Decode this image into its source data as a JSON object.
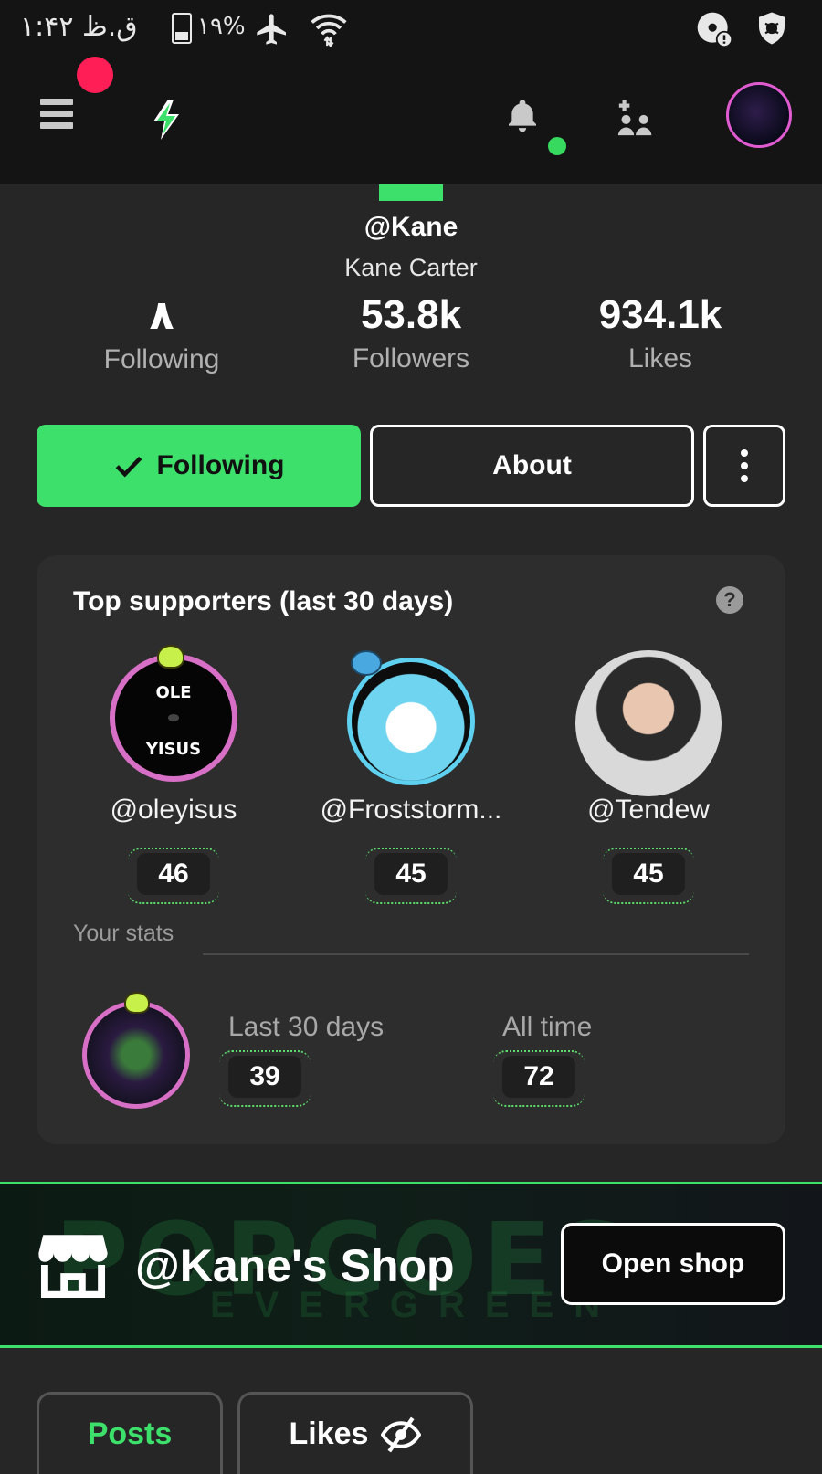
{
  "status_bar": {
    "time": "ق.ظ ۱:۴۲",
    "battery": "۱۹%"
  },
  "profile": {
    "username": "@Kane",
    "display_name": "Kane Carter",
    "stats": [
      {
        "value": "۸",
        "label": "Following"
      },
      {
        "value": "53.8k",
        "label": "Followers"
      },
      {
        "value": "934.1k",
        "label": "Likes"
      }
    ]
  },
  "actions": {
    "following_label": "Following",
    "about_label": "About"
  },
  "supporters": {
    "title": "Top supporters (last 30 days)",
    "items": [
      {
        "name": "@oleyisus",
        "score": "46",
        "avatar_text_top": "OLE",
        "avatar_text_bottom": "YISUS"
      },
      {
        "name": "@Froststorm...",
        "score": "45"
      },
      {
        "name": "@Tendew",
        "score": "45"
      }
    ],
    "your_stats_label": "Your stats",
    "last30_label": "Last 30 days",
    "last30_value": "39",
    "alltime_label": "All time",
    "alltime_value": "72"
  },
  "shop": {
    "title": "@Kane's Shop",
    "background_text": "POPGOES",
    "background_sub": "EVERGREEN",
    "button_label": "Open shop"
  },
  "tabs": [
    {
      "label": "Posts",
      "active": true
    },
    {
      "label": "Likes",
      "active": false
    }
  ],
  "colors": {
    "accent": "#3ce06a",
    "notification": "#ff1e56",
    "background": "#262626"
  }
}
